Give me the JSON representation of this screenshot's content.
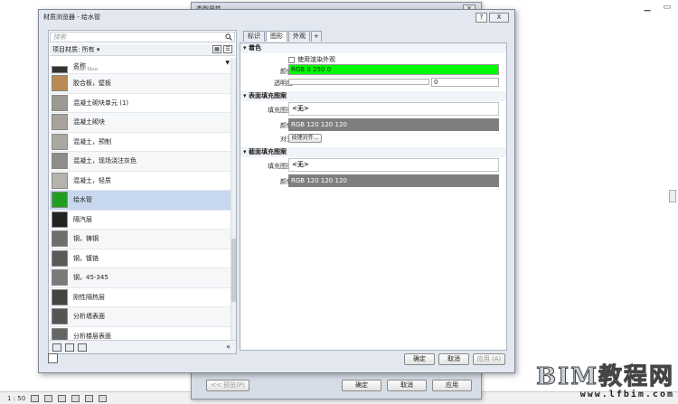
{
  "background": {
    "status_scale": "1 : 50"
  },
  "back_dialog": {
    "title": "类型属性",
    "close": "X",
    "preview_btn": "<< 预览(P)",
    "ok": "确定",
    "cancel": "取消",
    "apply": "应用"
  },
  "dialog": {
    "title": "材质浏览器 - 给水管",
    "help": "?",
    "close": "X"
  },
  "left": {
    "search_placeholder": "搜索",
    "filter_label": "项目材质: 所有",
    "header_name": "名称",
    "header_sub": "Aluac Sbuc",
    "items": [
      {
        "name": "胶合板，壁板",
        "color": "#b98a55"
      },
      {
        "name": "混凝土砌块单元 (1)",
        "color": "#9d9a94"
      },
      {
        "name": "混凝土砌块",
        "color": "#a7a39c"
      },
      {
        "name": "混凝土，预制",
        "color": "#aba8a2"
      },
      {
        "name": "混凝土，现场浇注灰色",
        "color": "#8f8d89"
      },
      {
        "name": "混凝土，轻质",
        "color": "#b6b3ae"
      },
      {
        "name": "给水管",
        "color": "#1f9e1f",
        "selected": true
      },
      {
        "name": "隔汽层",
        "color": "#222222"
      },
      {
        "name": "钢，铸钢",
        "color": "#6e6e6e"
      },
      {
        "name": "钢，镀铬",
        "color": "#5a5a5a"
      },
      {
        "name": "钢，45-345",
        "color": "#7a7a7a"
      },
      {
        "name": "刚性隔热层",
        "color": "#444444"
      },
      {
        "name": "分析墙表面",
        "color": "#555555"
      },
      {
        "name": "分析楼层表面",
        "color": "#666666"
      }
    ]
  },
  "tabs": [
    "标识",
    "图形",
    "外观",
    "+"
  ],
  "graphics": {
    "shading_title": "着色",
    "use_render": "使用渲染外观",
    "color_label": "颜色",
    "color_value": "RGB 0 250 0",
    "transparency_label": "透明度",
    "transparency_value": "0",
    "surface_title": "表面填充图案",
    "fill_label": "填充图案",
    "fill_value": "<无>",
    "surface_color_label": "颜色",
    "surface_color_value": "RGB 120 120 120",
    "align_label": "对齐",
    "align_btn": "纹理对齐...",
    "cut_title": "截面填充图案",
    "cut_fill_label": "填充图案",
    "cut_fill_value": "<无>",
    "cut_color_label": "颜色",
    "cut_color_value": "RGB 120 120 120"
  },
  "footer": {
    "ok": "确定",
    "cancel": "取消",
    "apply": "应用 (A)"
  },
  "watermark": {
    "big": "BIM教程网",
    "small": "www.lfbim.com"
  }
}
